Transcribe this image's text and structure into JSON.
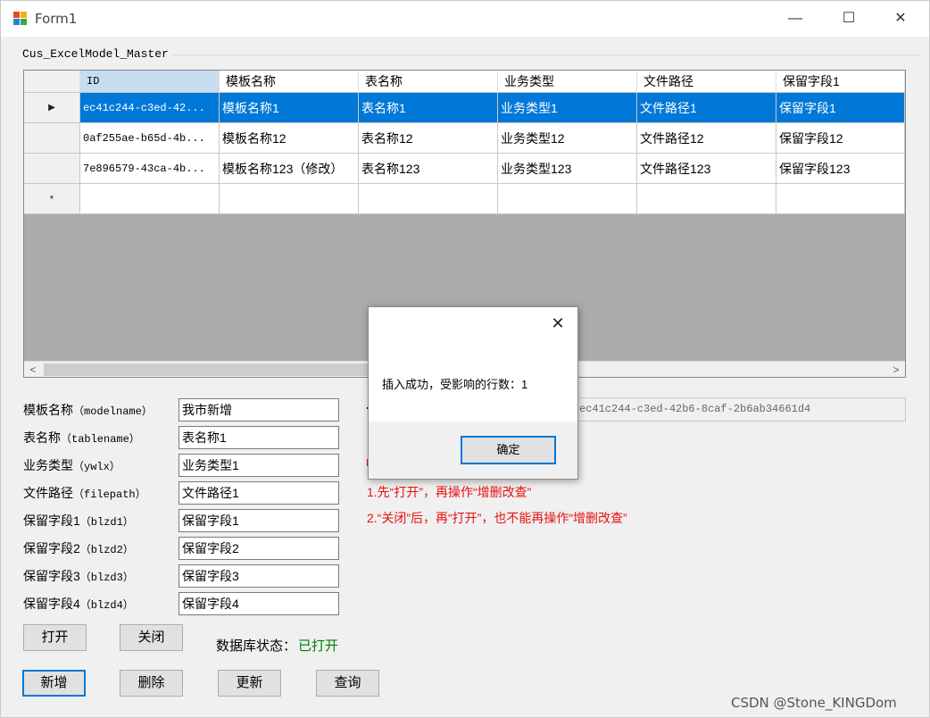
{
  "window": {
    "title": "Form1",
    "minimize_glyph": "—",
    "maximize_glyph": "☐",
    "close_glyph": "✕"
  },
  "group": {
    "label": "Cus_ExcelModel_Master"
  },
  "grid": {
    "columns": [
      "ID",
      "模板名称",
      "表名称",
      "业务类型",
      "文件路径",
      "保留字段1"
    ],
    "rows": [
      [
        "ec41c244-c3ed-42...",
        "模板名称1",
        "表名称1",
        "业务类型1",
        "文件路径1",
        "保留字段1"
      ],
      [
        "0af255ae-b65d-4b...",
        "模板名称12",
        "表名称12",
        "业务类型12",
        "文件路径12",
        "保留字段12"
      ],
      [
        "7e896579-43ca-4b...",
        "模板名称123（修改）",
        "表名称123",
        "业务类型123",
        "文件路径123",
        "保留字段123"
      ]
    ],
    "current_row_glyph": "▶",
    "new_row_glyph": "*",
    "scroll_left": "<",
    "scroll_right": ">"
  },
  "form": {
    "fields": [
      {
        "label": "模板名称",
        "sub": "（modelname）",
        "value": "我市新增"
      },
      {
        "label": "表名称",
        "sub": "（tablename）",
        "value": "表名称1"
      },
      {
        "label": "业务类型",
        "sub": "（ywlx）",
        "value": "业务类型1"
      },
      {
        "label": "文件路径",
        "sub": "（filepath）",
        "value": "文件路径1"
      },
      {
        "label": "保留字段1",
        "sub": "（blzd1）",
        "value": "保留字段1"
      },
      {
        "label": "保留字段2",
        "sub": "（blzd2）",
        "value": "保留字段2"
      },
      {
        "label": "保留字段3",
        "sub": "（blzd3）",
        "value": "保留字段3"
      },
      {
        "label": "保留字段4",
        "sub": "（blzd4）",
        "value": "保留字段4"
      }
    ],
    "id_value": "ec41c244-c3ed-42b6-8caf-2b6ab34661d4"
  },
  "notes": [
    "1.先“打开”，再操作“增删改查”",
    "2.“关闭”后，再“打开”，也不能再操作“增删改查”"
  ],
  "buttons": {
    "open": "打开",
    "close": "关闭",
    "add": "新增",
    "delete": "删除",
    "update": "更新",
    "query": "查询"
  },
  "status": {
    "label": "数据库状态：",
    "value": "已打开",
    "value_color": "#008000"
  },
  "dialog": {
    "message": "插入成功，受影响的行数：1",
    "ok_label": "确定",
    "close_glyph": "✕"
  },
  "watermark": "CSDN @Stone_KINGDom",
  "colors": {
    "selection": "#0078d7",
    "note": "#e81010",
    "window_bg": "#f0f0f0"
  }
}
